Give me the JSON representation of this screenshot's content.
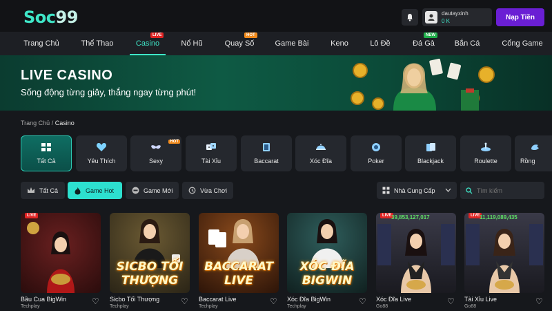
{
  "header": {
    "logo": {
      "prefix": "Soc",
      "suffix": "99"
    },
    "user": {
      "name": "dautayxinh",
      "balance": "0 K"
    },
    "deposit_label": "Nạp Tiền"
  },
  "nav": {
    "items": [
      {
        "label": "Trang Chủ"
      },
      {
        "label": "Thể Thao"
      },
      {
        "label": "Casino",
        "badge": "LIVE",
        "active": true
      },
      {
        "label": "Nổ Hũ"
      },
      {
        "label": "Quay Số",
        "badge": "HOT"
      },
      {
        "label": "Game Bài"
      },
      {
        "label": "Keno"
      },
      {
        "label": "Lô Đề"
      },
      {
        "label": "Đá Gà",
        "badge": "NEW"
      },
      {
        "label": "Bắn Cá"
      },
      {
        "label": "Cổng Game"
      }
    ]
  },
  "banner": {
    "title": "LIVE CASINO",
    "subtitle": "Sống động từng giây, thắng ngay từng phút!"
  },
  "breadcrumb": {
    "home": "Trang Chủ",
    "sep": "/",
    "current": "Casino"
  },
  "categories": [
    {
      "label": "Tất Cả",
      "icon": "grid-icon",
      "active": true
    },
    {
      "label": "Yêu Thích",
      "icon": "heart-icon"
    },
    {
      "label": "Sexy",
      "icon": "mask-icon",
      "badge": "HOT"
    },
    {
      "label": "Tài Xỉu",
      "icon": "dice-icon"
    },
    {
      "label": "Baccarat",
      "icon": "cards-icon"
    },
    {
      "label": "Xóc Đĩa",
      "icon": "bowl-icon"
    },
    {
      "label": "Poker",
      "icon": "chip-icon"
    },
    {
      "label": "Blackjack",
      "icon": "card-hand-icon"
    },
    {
      "label": "Roulette",
      "icon": "roulette-icon"
    },
    {
      "label": "Rồng",
      "icon": "dragon-icon"
    }
  ],
  "filters": [
    {
      "label": "Tất Cả",
      "icon": "crown-icon"
    },
    {
      "label": "Game Hot",
      "icon": "flame-icon",
      "active": true
    },
    {
      "label": "Game Mới",
      "icon": "new-icon"
    },
    {
      "label": "Vừa Chơi",
      "icon": "history-icon"
    }
  ],
  "provider_label": "Nhà Cung Cấp",
  "search_placeholder": "Tìm kiếm",
  "games": [
    {
      "title": "Bầu Cua BigWin",
      "provider": "Techplay",
      "live": "LIVE",
      "bg": "#5a1a1a"
    },
    {
      "title": "Sicbo Tối Thượng",
      "provider": "Techplay",
      "art": "SICBO TỐI THƯỢNG",
      "bg": "#3a3020"
    },
    {
      "title": "Baccarat Live",
      "provider": "Techplay",
      "art": "BACCARAT LIVE",
      "bg": "#5a2a10"
    },
    {
      "title": "Xóc Đĩa BigWin",
      "provider": "Techplay",
      "art": "XÓC ĐĨA BIGWIN",
      "bg": "#1c3a3a"
    },
    {
      "title": "Xóc Đĩa Live",
      "provider": "Go88",
      "live": "LIVE",
      "jackpot": "39,853,127,017",
      "bg": "#2a2a30"
    },
    {
      "title": "Tài Xỉu Live",
      "provider": "Go88",
      "live": "LIVE",
      "jackpot": "11,119,089,435",
      "bg": "#2a2a30"
    }
  ]
}
